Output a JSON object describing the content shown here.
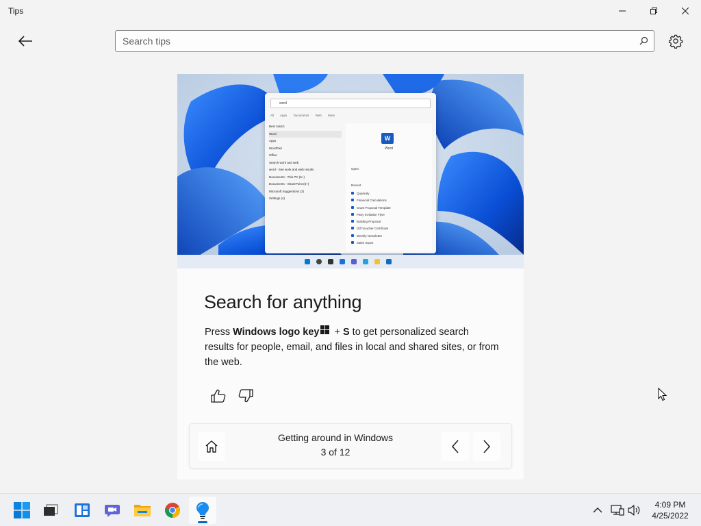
{
  "window": {
    "title": "Tips"
  },
  "search": {
    "placeholder": "Search tips",
    "value": ""
  },
  "hero": {
    "search_query": "word",
    "tabs": [
      "All",
      "Apps",
      "Documents",
      "Web",
      "More"
    ],
    "best_match_label": "Best match",
    "best_match": "Word",
    "apps_label": "Apps",
    "apps": [
      "WordPad",
      "Office"
    ],
    "web_label": "Search work and web",
    "web_item": "word - See work and web results",
    "other_items": [
      "Documents - This PC (5+)",
      "Documents - SharePoint (5+)",
      "Microsoft Suggestions (2)",
      "Settings (4)"
    ],
    "right_title": "Word",
    "open_label": "Open",
    "recent_label": "Recent",
    "recent_items": [
      "Quarterly",
      "Financial Calculations",
      "Grant Proposal Template",
      "Party Invitation Flyer",
      "Building Proposal",
      "Gift Voucher Certificate",
      "Weekly Newsletter",
      "Sales report"
    ]
  },
  "tip": {
    "title": "Search for anything",
    "body_prefix": "Press ",
    "body_key": "Windows logo key",
    "body_plus": " + ",
    "body_s": "S",
    "body_rest": " to get personalized search results for people, email, and files in local and shared sites, or from the web."
  },
  "navigation": {
    "collection_title": "Getting around in Windows",
    "position": "3 of 12"
  },
  "taskbar": {
    "time": "4:09 PM",
    "date": "4/25/2022",
    "apps": [
      "start-icon",
      "task-view-icon",
      "widgets-icon",
      "teams-chat-icon",
      "file-explorer-icon",
      "chrome-icon",
      "tips-icon"
    ]
  },
  "colors": {
    "accent": "#0067c0",
    "windows_blue": "#0078d4",
    "word_blue": "#185abd"
  }
}
